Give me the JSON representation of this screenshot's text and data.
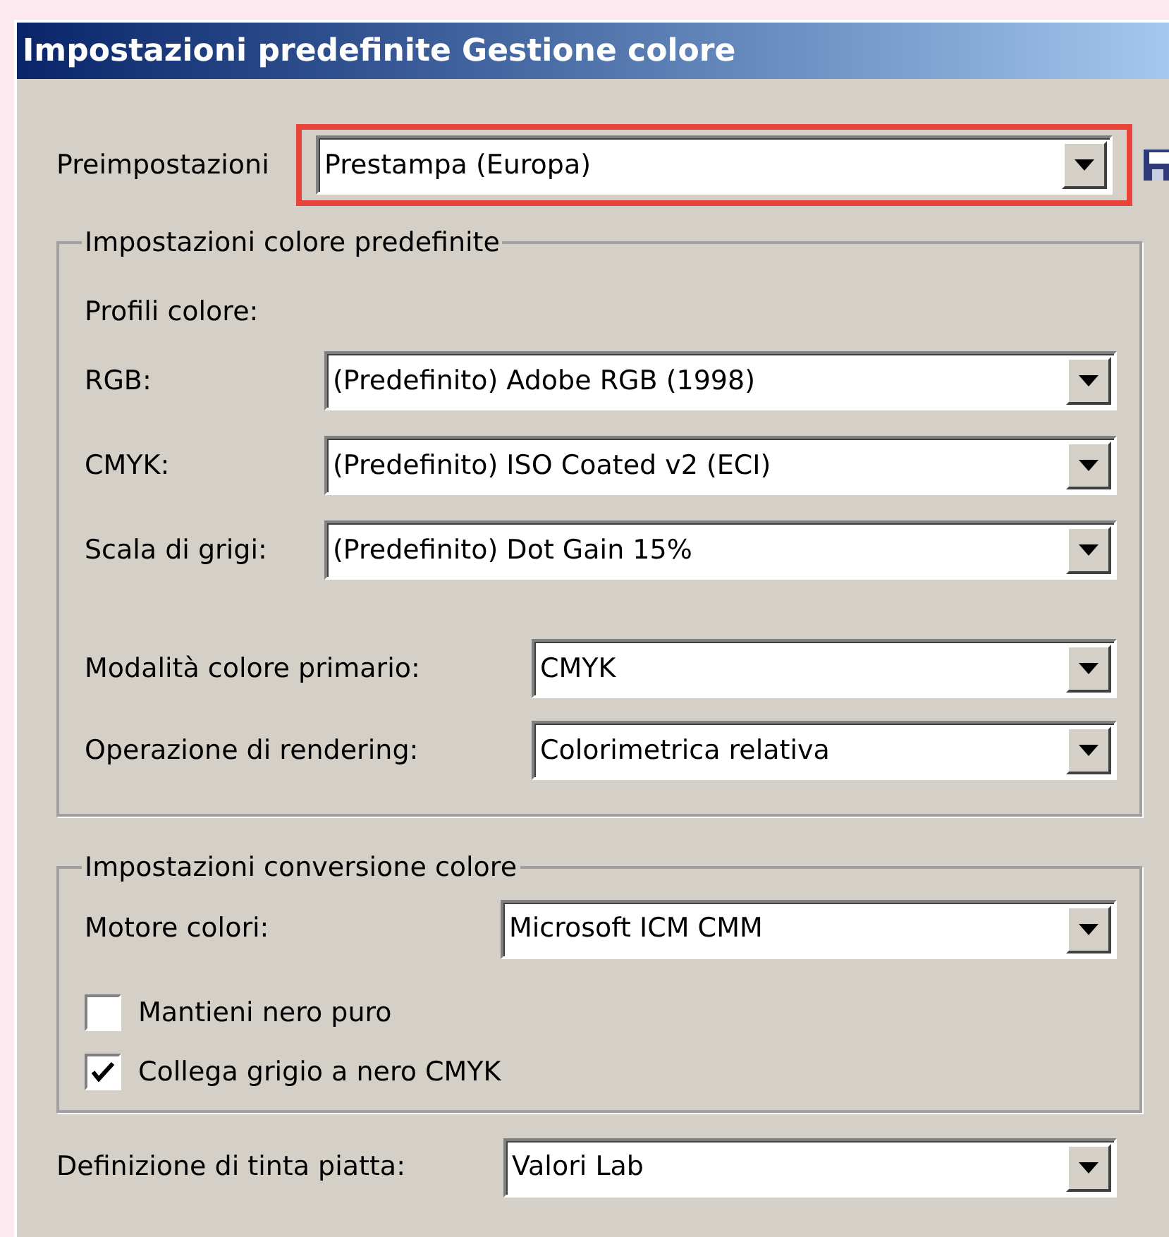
{
  "window": {
    "title": "Impostazioni predefinite Gestione colore"
  },
  "preset": {
    "label": "Preimpostazioni",
    "value": "Prestampa (Europa)",
    "highlighted": true
  },
  "default_settings": {
    "legend": "Impostazioni colore predefinite",
    "subheading": "Profili colore:",
    "profiles": [
      {
        "label": "RGB:",
        "value": "(Predefinito) Adobe RGB (1998)"
      },
      {
        "label": "CMYK:",
        "value": "(Predefinito) ISO Coated v2 (ECI)"
      },
      {
        "label": "Scala di grigi:",
        "value": "(Predefinito) Dot Gain 15%"
      }
    ],
    "modes": [
      {
        "label": "Modalità colore primario:",
        "value": "CMYK"
      },
      {
        "label": "Operazione di rendering:",
        "value": "Colorimetrica relativa"
      }
    ]
  },
  "conversion_settings": {
    "legend": "Impostazioni conversione colore",
    "engine": {
      "label": "Motore colori:",
      "value": "Microsoft ICM CMM"
    },
    "options": [
      {
        "label": "Mantieni nero puro",
        "checked": false
      },
      {
        "label": "Collega grigio a nero CMYK",
        "checked": true
      }
    ]
  },
  "spot_color": {
    "label": "Definizione di tinta piatta:",
    "value": "Valori Lab"
  }
}
